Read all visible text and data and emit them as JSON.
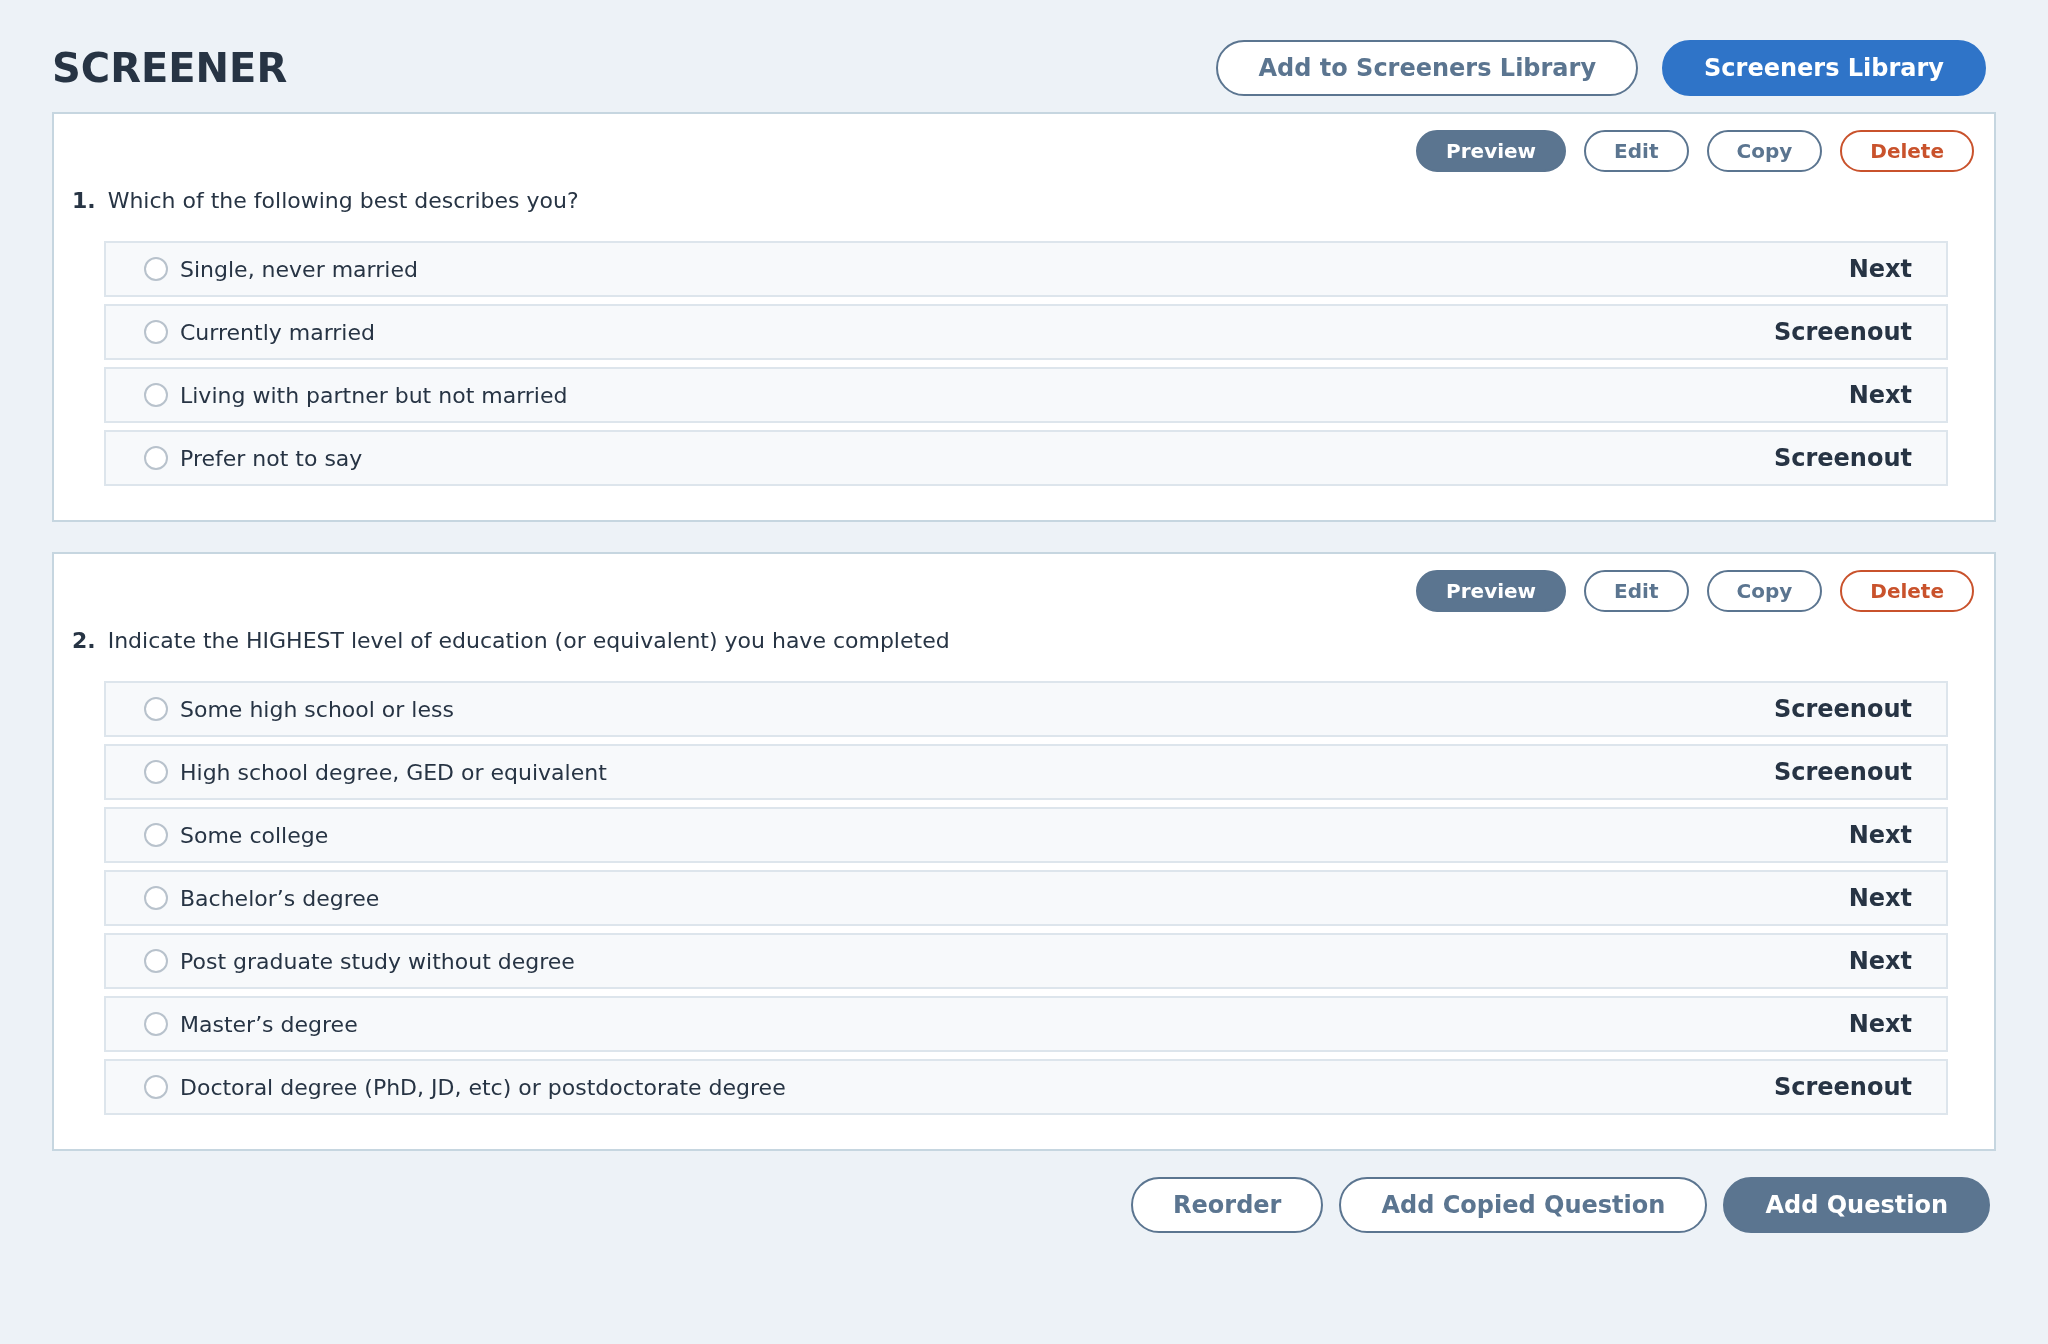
{
  "title": "SCREENER",
  "header_buttons": [
    {
      "label": "Add to Screeners Library",
      "kind": "outline"
    },
    {
      "label": "Screeners Library",
      "kind": "primary"
    }
  ],
  "questions": [
    {
      "number": "1.",
      "text": "Which of the following best describes you?",
      "actions": [
        {
          "label": "Preview",
          "kind": "filled"
        },
        {
          "label": "Edit",
          "kind": "outline"
        },
        {
          "label": "Copy",
          "kind": "outline"
        },
        {
          "label": "Delete",
          "kind": "danger"
        }
      ],
      "options": [
        {
          "label": "Single, never married",
          "outcome": "Next",
          "selected": false
        },
        {
          "label": "Currently married",
          "outcome": "Screenout",
          "selected": false
        },
        {
          "label": "Living with partner but not married",
          "outcome": "Next",
          "selected": false
        },
        {
          "label": "Prefer not to say",
          "outcome": "Screenout",
          "selected": false
        }
      ]
    },
    {
      "number": "2.",
      "text": "Indicate the HIGHEST level of education (or equivalent) you have completed",
      "actions": [
        {
          "label": "Preview",
          "kind": "filled"
        },
        {
          "label": "Edit",
          "kind": "outline"
        },
        {
          "label": "Copy",
          "kind": "outline"
        },
        {
          "label": "Delete",
          "kind": "danger"
        }
      ],
      "options": [
        {
          "label": "Some high school or less",
          "outcome": "Screenout",
          "selected": false
        },
        {
          "label": "High school degree, GED or equivalent",
          "outcome": "Screenout",
          "selected": false
        },
        {
          "label": "Some college",
          "outcome": "Next",
          "selected": false
        },
        {
          "label": "Bachelor’s degree",
          "outcome": "Next",
          "selected": false
        },
        {
          "label": "Post graduate study without degree",
          "outcome": "Next",
          "selected": false
        },
        {
          "label": "Master’s degree",
          "outcome": "Next",
          "selected": false
        },
        {
          "label": "Doctoral degree (PhD, JD, etc) or postdoctorate degree",
          "outcome": "Screenout",
          "selected": false
        }
      ]
    }
  ],
  "footer_buttons": [
    {
      "label": "Reorder",
      "kind": "outline"
    },
    {
      "label": "Add Copied Question",
      "kind": "outline"
    },
    {
      "label": "Add Question",
      "kind": "filled"
    }
  ]
}
